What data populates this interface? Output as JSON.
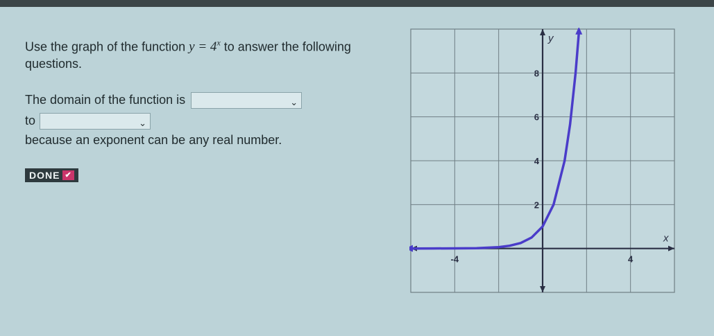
{
  "question": {
    "intro_before": "Use the graph of the function",
    "equation_base": "y = 4",
    "equation_exponent": "x",
    "intro_after": "to answer the following questions.",
    "line2_prefix": "The domain of the function is",
    "line3_prefix": "to",
    "line4": "because an exponent can be any real number."
  },
  "dropdowns": [
    {
      "id": "domain-start",
      "value": ""
    },
    {
      "id": "domain-end",
      "value": ""
    }
  ],
  "done_button": {
    "label": "DONE",
    "check": "✔"
  },
  "chart_data": {
    "type": "line",
    "function": "y = 4^x",
    "xlabel": "x",
    "ylabel": "y",
    "x_tick_labels": [
      "-4",
      "4"
    ],
    "y_tick_labels": [
      "2",
      "4",
      "6",
      "8"
    ],
    "xlim": [
      -6,
      6
    ],
    "ylim": [
      -2,
      10
    ],
    "grid": true,
    "series": [
      {
        "x": [
          -6,
          -5,
          -4,
          -3,
          -2,
          -1.5,
          -1,
          -0.5,
          0,
          0.5,
          1,
          1.25,
          1.5,
          1.65
        ],
        "y": [
          0.0002,
          0.001,
          0.004,
          0.016,
          0.0625,
          0.125,
          0.25,
          0.5,
          1,
          2,
          4,
          5.66,
          8,
          9.85
        ]
      }
    ],
    "colors": {
      "curve": "#4a3cc9",
      "axis": "#2a2f44",
      "grid": "#6f7e84"
    }
  }
}
